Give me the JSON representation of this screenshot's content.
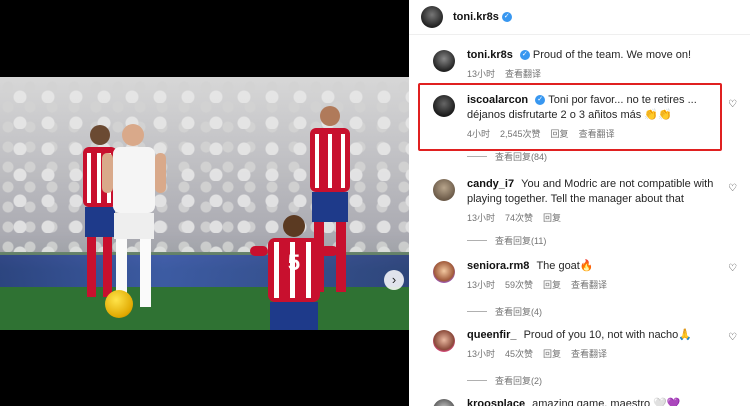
{
  "post": {
    "author": "toni.kr8s",
    "photo_alt_icon": "football-photo",
    "carousel_next_icon": "chevron-right-icon"
  },
  "comments": [
    {
      "username": "toni.kr8s",
      "verified": true,
      "text": "Proud of the team. We move on!",
      "time": "13小时",
      "likes": "",
      "reply": "",
      "translate": "查看翻译",
      "replies": ""
    },
    {
      "username": "iscoalarcon",
      "verified": true,
      "text": "Toni por favor... no te retires ... déjanos disfrutarte 2 o 3 añitos más 👏👏",
      "time": "4小时",
      "likes": "2,545次赞",
      "reply": "回复",
      "translate": "查看翻译",
      "replies": "查看回复(84)"
    },
    {
      "username": "candy_i7",
      "verified": false,
      "text": "You and Modric are not compatible with playing together. Tell the manager about that",
      "time": "13小时",
      "likes": "74次赞",
      "reply": "回复",
      "translate": "",
      "replies": "查看回复(11)"
    },
    {
      "username": "seniora.rm8",
      "verified": false,
      "text": "The goat🔥",
      "time": "13小时",
      "likes": "59次赞",
      "reply": "回复",
      "translate": "查看翻译",
      "replies": "查看回复(4)"
    },
    {
      "username": "queenfir_",
      "verified": false,
      "text": "Proud of you 10, not with nacho🙏",
      "time": "13小时",
      "likes": "45次赞",
      "reply": "回复",
      "translate": "查看翻译",
      "replies": "查看回复(2)"
    },
    {
      "username": "kroosplace",
      "verified": false,
      "text": "amazing game, maestro 🤍💜",
      "time": "",
      "likes": "",
      "reply": "",
      "translate": "",
      "replies": ""
    }
  ],
  "colors": {
    "highlight_border": "#e02020",
    "verified": "#3897f0",
    "meta_text": "#737373"
  }
}
